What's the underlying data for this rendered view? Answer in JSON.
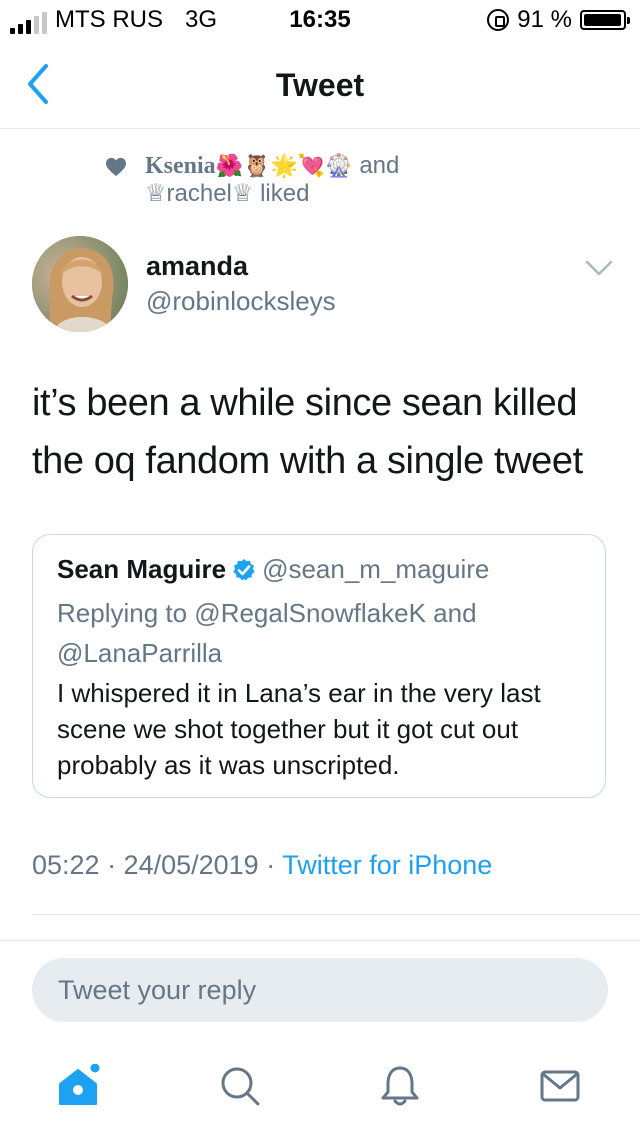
{
  "status_bar": {
    "carrier": "MTS RUS",
    "network": "3G",
    "time": "16:35",
    "battery_percent_text": "91 %",
    "battery_level": 0.91
  },
  "nav": {
    "title": "Tweet",
    "back_icon": "chevron-left-icon"
  },
  "liked_by": {
    "liker1_name": "Ksenia",
    "liker1_emojis": "🌺🦉🌟💘🎡",
    "and_text": "and",
    "liker2_name": "♕rachel♕",
    "liked_text": "liked"
  },
  "tweet": {
    "display_name": "amanda",
    "handle": "@robinlocksleys",
    "text": "it’s been a while since sean killed the oq fandom with a single tweet",
    "timestamp": "05:22 · 24/05/2019 ·",
    "source": "Twitter for iPhone"
  },
  "quoted_tweet": {
    "display_name": "Sean Maguire",
    "handle": "@sean_m_maguire",
    "replying_to": "Replying to @RegalSnowflakeK and @LanaParrilla",
    "text": "I whispered it in Lana’s ear in the very last scene we shot together but it got cut out probably as it was unscripted."
  },
  "reply": {
    "placeholder": "Tweet your reply"
  },
  "tab_bar": {
    "icons": [
      "home-icon",
      "search-icon",
      "notifications-icon",
      "messages-icon"
    ]
  },
  "colors": {
    "accent": "#1da1f2",
    "secondary_text": "#657786",
    "primary_text": "#14171a"
  }
}
